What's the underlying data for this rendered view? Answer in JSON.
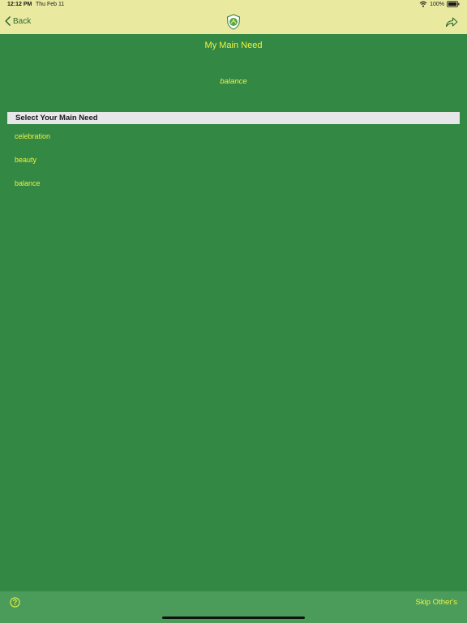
{
  "status_bar": {
    "time": "12:12 PM",
    "date": "Thu Feb 11",
    "battery": "100%"
  },
  "nav": {
    "back_label": "Back",
    "icons": {
      "back": "chevron-left-icon",
      "share": "share-arrow-icon",
      "logo": "app-logo-emblem"
    }
  },
  "page": {
    "title": "My Main Need",
    "selected_value": "balance"
  },
  "section": {
    "header": "Select Your Main Need",
    "options": [
      "celebration",
      "beauty",
      "balance"
    ]
  },
  "bottom_bar": {
    "skip_label": "Skip Other's",
    "icons": {
      "help": "question-circle-icon"
    }
  },
  "colors": {
    "background": "#338844",
    "top_bar": "#e9e9a0",
    "bottom_bar": "#4b9c5b",
    "accent_text": "#f2f240",
    "section_header": "#e7e7e9"
  }
}
